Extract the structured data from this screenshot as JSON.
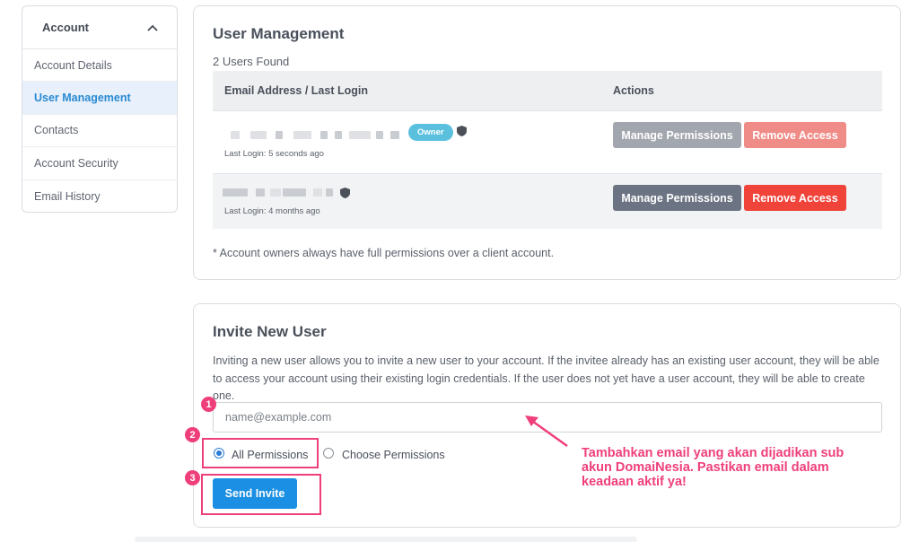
{
  "sidebar": {
    "header": "Account",
    "items": [
      {
        "label": "Account Details"
      },
      {
        "label": "User Management"
      },
      {
        "label": "Contacts"
      },
      {
        "label": "Account Security"
      },
      {
        "label": "Email History"
      }
    ]
  },
  "user_management": {
    "title": "User Management",
    "count_text": "2 Users Found",
    "columns": [
      "Email Address / Last Login",
      "Actions"
    ],
    "rows": [
      {
        "owner_badge": "Owner",
        "last_login": "Last Login: 5 seconds ago",
        "manage_label": "Manage Permissions",
        "remove_label": "Remove Access"
      },
      {
        "last_login": "Last Login: 4 months ago",
        "manage_label": "Manage Permissions",
        "remove_label": "Remove Access"
      }
    ],
    "footnote": "* Account owners always have full permissions over a client account."
  },
  "invite": {
    "title": "Invite New User",
    "description": "Inviting a new user allows you to invite a new user to your account. If the invitee already has an existing user account, they will be able to access your account using their existing login credentials. If the user does not yet have a user account, they will be able to create one.",
    "email_placeholder": "name@example.com",
    "option_all": "All Permissions",
    "option_choose": "Choose Permissions",
    "selected_option": "All Permissions",
    "send_label": "Send Invite"
  },
  "annotations": {
    "steps": [
      "1",
      "2",
      "3"
    ],
    "note": "Tambahkan email yang akan dijadikan sub akun DomaiNesia. Pastikan email dalam keadaan aktif ya!",
    "color": "#ef3f7a"
  },
  "colors": {
    "accent": "#2a89d1",
    "send_button": "#1a8fe3",
    "remove_active": "#f0433a",
    "owner_badge": "#5bc0de"
  }
}
